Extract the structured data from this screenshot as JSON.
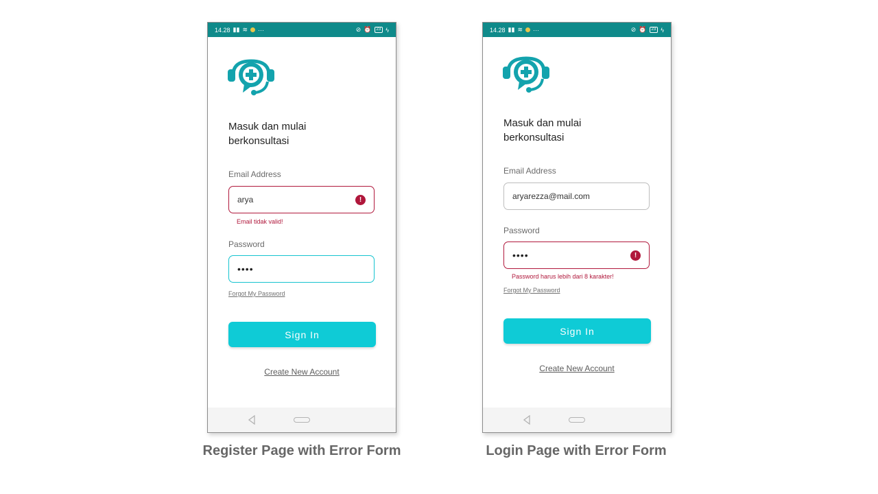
{
  "status_bar": {
    "time": "14.28",
    "battery": "23"
  },
  "register": {
    "heading_line1": "Masuk dan mulai",
    "heading_line2": "berkonsultasi",
    "email_label": "Email Address",
    "email_value": "arya",
    "email_error": "Email tidak valid!",
    "password_label": "Password",
    "password_value": "••••",
    "forgot": "Forgot My Password",
    "sign_in": "Sign In",
    "create": "Create New Account",
    "caption": "Register Page with Error Form"
  },
  "login": {
    "heading_line1": "Masuk dan mulai",
    "heading_line2": "berkonsultasi",
    "email_label": "Email Address",
    "email_value": "aryarezza@mail.com",
    "password_label": "Password",
    "password_value": "••••",
    "password_error": "Password harus lebih dari 8 karakter!",
    "forgot": "Forgot My Password",
    "sign_in": "Sign In",
    "create": "Create New Account",
    "caption": "Login Page with Error Form"
  },
  "colors": {
    "status_bar": "#0f8a8a",
    "accent": "#0fcbd6",
    "error": "#b0173b",
    "logo": "#13a3ad"
  }
}
